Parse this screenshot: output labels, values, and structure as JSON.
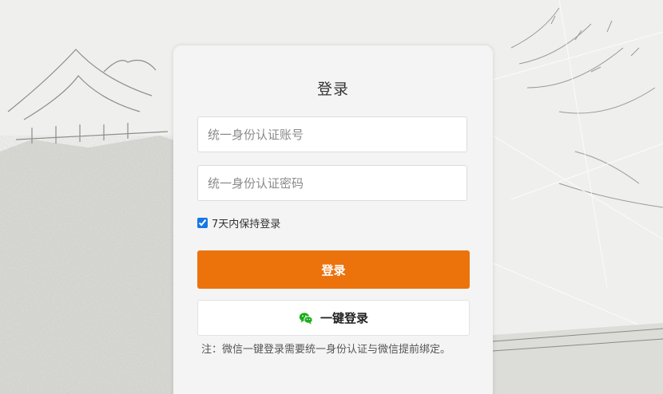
{
  "login": {
    "title": "登录",
    "account_placeholder": "统一身份认证账号",
    "password_placeholder": "统一身份认证密码",
    "remember_label": "7天内保持登录",
    "remember_checked": true,
    "submit_label": "登录",
    "wechat_label": "一键登录",
    "wechat_icon": "wechat-icon",
    "note": "注：微信一键登录需要统一身份认证与微信提前绑定。"
  },
  "colors": {
    "primary": "#ec720c",
    "wechat": "#1aad19",
    "checkbox": "#1677e6"
  }
}
